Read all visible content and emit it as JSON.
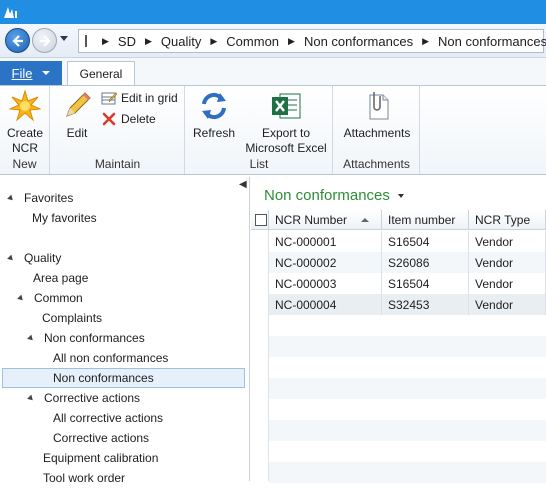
{
  "address": {
    "crumbs": [
      "SD",
      "Quality",
      "Common",
      "Non conformances",
      "Non conformances"
    ]
  },
  "ribbon": {
    "file_label": "File",
    "tab_general": "General",
    "groups": {
      "new": {
        "label": "New",
        "create": "Create NCR"
      },
      "maintain": {
        "label": "Maintain",
        "edit": "Edit",
        "edit_in_grid": "Edit in grid",
        "delete": "Delete"
      },
      "list": {
        "label": "List",
        "refresh": "Refresh",
        "export": "Export to Microsoft Excel"
      },
      "attachments": {
        "label": "Attachments",
        "attachments": "Attachments"
      }
    }
  },
  "sidebar": {
    "favorites": "Favorites",
    "my_favorites": "My favorites",
    "quality": "Quality",
    "area_page": "Area page",
    "common": "Common",
    "complaints": "Complaints",
    "non_conformances": "Non conformances",
    "all_non_conformances": "All non conformances",
    "non_conformances_selected": "Non conformances",
    "corrective_actions": "Corrective actions",
    "all_corrective_actions": "All corrective actions",
    "corrective_actions_sub": "Corrective actions",
    "equipment_calibration": "Equipment calibration",
    "tool_work_order": "Tool work order"
  },
  "grid": {
    "title": "Non conformances",
    "columns": [
      "NCR Number",
      "Item number",
      "NCR Type"
    ],
    "rows": [
      [
        "NC-000001",
        "S16504",
        "Vendor"
      ],
      [
        "NC-000002",
        "S26086",
        "Vendor"
      ],
      [
        "NC-000003",
        "S16504",
        "Vendor"
      ],
      [
        "NC-000004",
        "S32453",
        "Vendor"
      ]
    ]
  },
  "colors": {
    "title_bar": "#1f8ee3",
    "accent_green": "#2c8f35",
    "file_tab": "#2a73c5"
  }
}
